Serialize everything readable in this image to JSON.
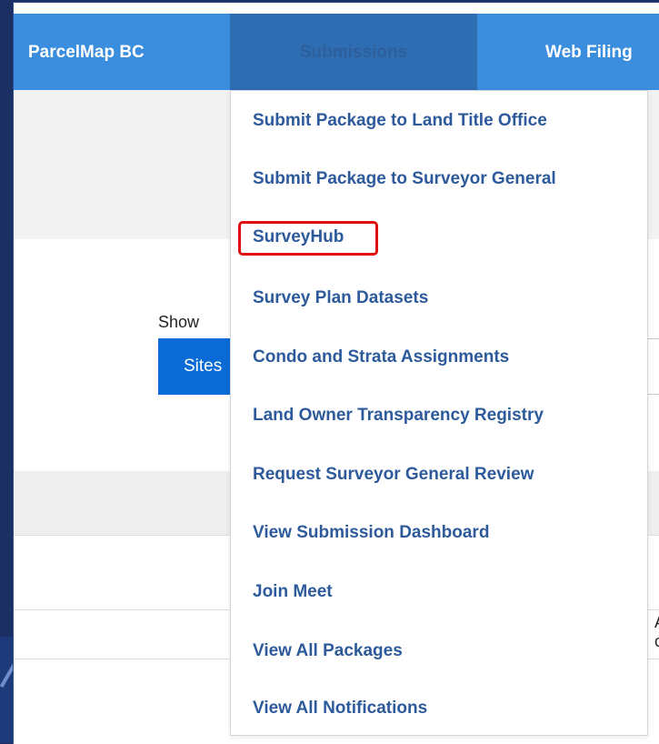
{
  "navbar": {
    "items": [
      {
        "label": "ParcelMap BC"
      },
      {
        "label": "Submissions"
      },
      {
        "label": "Web Filing"
      }
    ]
  },
  "page": {
    "show_label": "Show",
    "sites_button": "Sites",
    "clipped_row_text": "A c"
  },
  "dropdown": {
    "items": [
      {
        "label": "Submit Package to Land Title Office"
      },
      {
        "label": "Submit Package to Surveyor General"
      },
      {
        "label": "SurveyHub",
        "highlighted": true
      },
      {
        "label": "Survey Plan Datasets"
      },
      {
        "label": "Condo and Strata Assignments"
      },
      {
        "label": "Land Owner Transparency Registry"
      },
      {
        "label": "Request Surveyor General Review"
      },
      {
        "label": "View Submission Dashboard"
      },
      {
        "label": "Join Meet"
      },
      {
        "label": "View All Packages"
      },
      {
        "label": "View All Notifications"
      }
    ],
    "highlight_color": "#e01010"
  },
  "colors": {
    "navbar": "#3b8ede",
    "active_tab": "#2f6db2",
    "menu_text": "#2d5a9a",
    "button": "#0a6bd6"
  }
}
